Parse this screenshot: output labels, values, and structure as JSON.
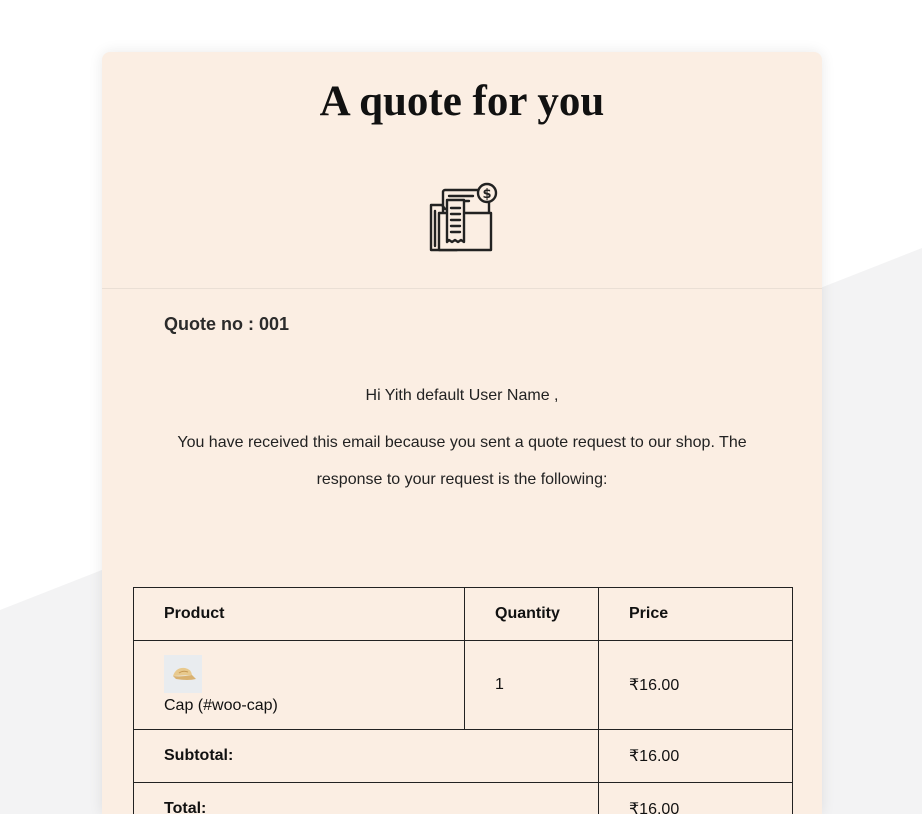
{
  "email": {
    "title": "A quote for you",
    "header_icon": "invoice-document-icon",
    "quote_number": "Quote no : 001",
    "greeting": "Hi Yith default User Name ,",
    "message": "You have received this email because you sent a quote request to our shop. The response to your request is the following:"
  },
  "table": {
    "headers": [
      "Product",
      "Quantity",
      "Price"
    ],
    "items": [
      {
        "thumbnail": "cap-thumbnail",
        "name": "Cap (#woo-cap)",
        "quantity": "1",
        "price": "₹16.00"
      }
    ],
    "subtotal_label": "Subtotal:",
    "subtotal_value": "₹16.00",
    "total_label": "Total:",
    "total_value": "₹16.00"
  },
  "colors": {
    "card_background": "#fbeee3",
    "page_background": "#ffffff",
    "background_shape": "#f3f3f4",
    "text": "#1f1f1f",
    "table_border": "#222222"
  }
}
